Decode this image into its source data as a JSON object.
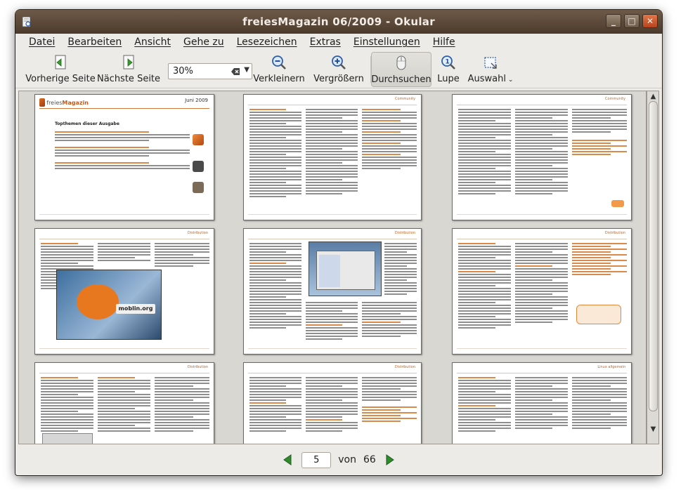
{
  "window": {
    "title": "freiesMagazin 06/2009 - Okular"
  },
  "menu": [
    "Datei",
    "Bearbeiten",
    "Ansicht",
    "Gehe zu",
    "Lesezeichen",
    "Extras",
    "Einstellungen",
    "Hilfe"
  ],
  "toolbar": {
    "prev_label": "Vorherige Seite",
    "next_label": "Nächste Seite",
    "zoom_value": "30%",
    "zoom_out_label": "Verkleinern",
    "zoom_in_label": "Vergrößern",
    "browse_label": "Durchsuchen",
    "magnify_label": "Lupe",
    "select_label": "Auswahl"
  },
  "pages": {
    "cover_brand_plain": "freies",
    "cover_brand_bold": "Magazin",
    "cover_date": "Juni 2009",
    "cover_heading": "Topthemen dieser Ausgabe",
    "header_distribution": "Distribution",
    "header_community": "Community",
    "header_moblin": "Distribution",
    "header_linux": "Linux allgemein",
    "moblin_logo_text": "moblin.org"
  },
  "navigation": {
    "current_page": "5",
    "of_label": "von",
    "total_pages": "66"
  },
  "colors": {
    "accent": "#e06d1e",
    "nav_green": "#2e8b2e",
    "titlebar": "#5a4636"
  }
}
